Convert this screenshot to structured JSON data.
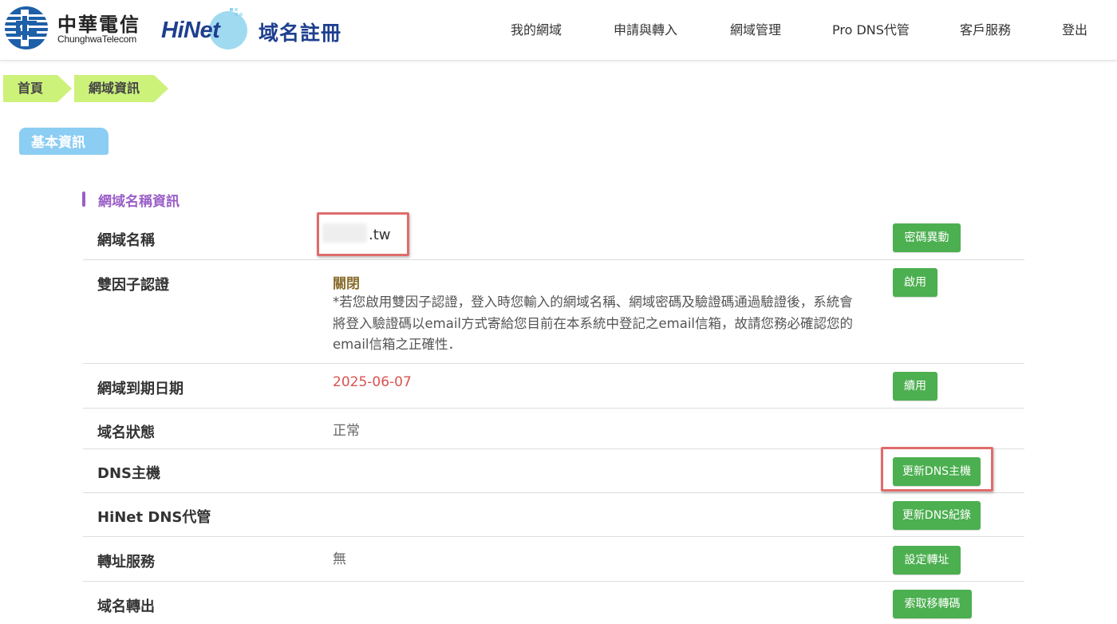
{
  "header": {
    "cht_name": "中華電信",
    "cht_name_en": "ChunghwaTelecom",
    "hinet_word": "HiNet",
    "hinet_sub": "域名註冊",
    "brand_color": "#1e3f8f"
  },
  "nav": {
    "items": [
      "我的網域",
      "申請與轉入",
      "網域管理",
      "Pro DNS代管",
      "客戶服務",
      "登出"
    ]
  },
  "breadcrumb": {
    "home": "首頁",
    "current": "網域資訊"
  },
  "section": {
    "tab_label": "基本資訊",
    "sub_title": "網域名稱資訊"
  },
  "rows": {
    "domain_name": {
      "label": "網域名稱",
      "value": ".tw",
      "button": "密碼異動"
    },
    "two_factor": {
      "label": "雙因子認證",
      "status": "關閉",
      "description": "*若您啟用雙因子認證，登入時您輸入的網域名稱、網域密碼及驗證碼通過驗證後，系統會將登入驗證碼以email方式寄給您目前在本系統中登記之email信箱，故請您務必確認您的email信箱之正確性．",
      "button": "啟用"
    },
    "expiry": {
      "label": "網域到期日期",
      "value": "2025-06-07",
      "button": "續用"
    },
    "status": {
      "label": "域名狀態",
      "value": "正常"
    },
    "dns_host": {
      "label": "DNS主機",
      "button": "更新DNS主機"
    },
    "hinet_dns": {
      "label": "HiNet DNS代管",
      "button": "更新DNS紀錄"
    },
    "forwarding": {
      "label": "轉址服務",
      "value": "無",
      "button": "設定轉址"
    },
    "transfer_out": {
      "label": "域名轉出",
      "button": "索取移轉碼"
    }
  },
  "colors": {
    "button_green": "#4caf50",
    "breadcrumb_green": "#ccf27a",
    "tab_blue": "#8ccdf3",
    "subtitle_purple": "#9b5fc8",
    "date_red": "#d9534f",
    "highlight_red": "#e06b6b"
  }
}
